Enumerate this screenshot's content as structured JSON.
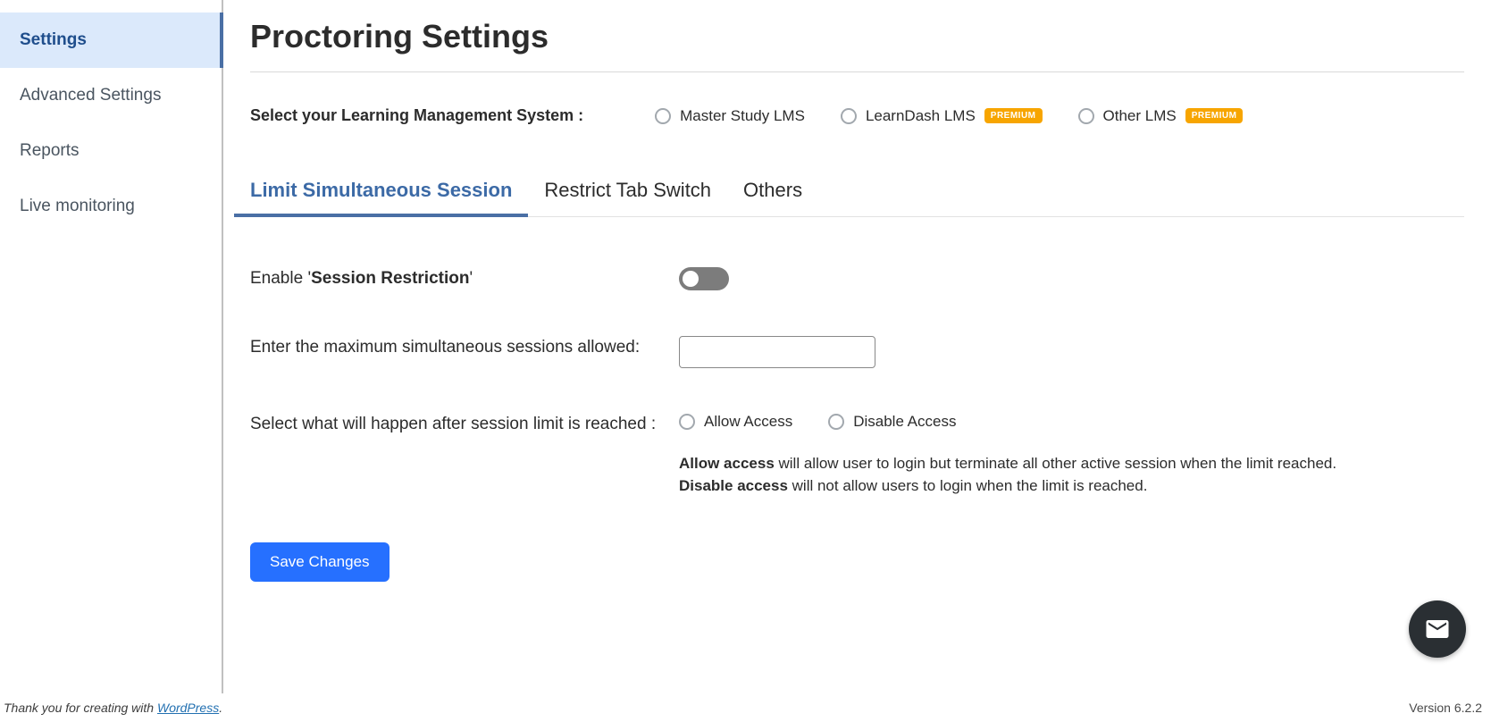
{
  "sidebar": {
    "items": [
      {
        "label": "Settings",
        "active": true
      },
      {
        "label": "Advanced Settings",
        "active": false
      },
      {
        "label": "Reports",
        "active": false
      },
      {
        "label": "Live monitoring",
        "active": false
      }
    ]
  },
  "page": {
    "title": "Proctoring Settings"
  },
  "lms": {
    "label": "Select your Learning Management System :",
    "options": [
      {
        "label": "Master Study LMS",
        "premium": false
      },
      {
        "label": "LearnDash LMS",
        "premium": true
      },
      {
        "label": "Other LMS",
        "premium": true
      }
    ],
    "premium_badge": "PREMIUM"
  },
  "tabs": [
    {
      "label": "Limit Simultaneous Session",
      "active": true
    },
    {
      "label": "Restrict Tab Switch",
      "active": false
    },
    {
      "label": "Others",
      "active": false
    }
  ],
  "session": {
    "enable_prefix": "Enable '",
    "enable_bold": "Session Restriction",
    "enable_suffix": "'",
    "toggle_on": false,
    "max_label": "Enter the maximum simultaneous sessions allowed:",
    "max_value": "",
    "action_label": "Select what will happen after session limit is reached :",
    "options": {
      "allow": "Allow Access",
      "disable": "Disable Access"
    },
    "desc": {
      "allow_bold": "Allow access",
      "allow_rest": " will allow user to login but terminate all other active session when the limit reached.",
      "disable_bold": "Disable access",
      "disable_rest": " will not allow users to login when the limit is reached."
    }
  },
  "buttons": {
    "save": "Save Changes"
  },
  "footer": {
    "prefix": "Thank you for creating with ",
    "link_text": "WordPress",
    "suffix": ".",
    "version": "Version 6.2.2"
  }
}
